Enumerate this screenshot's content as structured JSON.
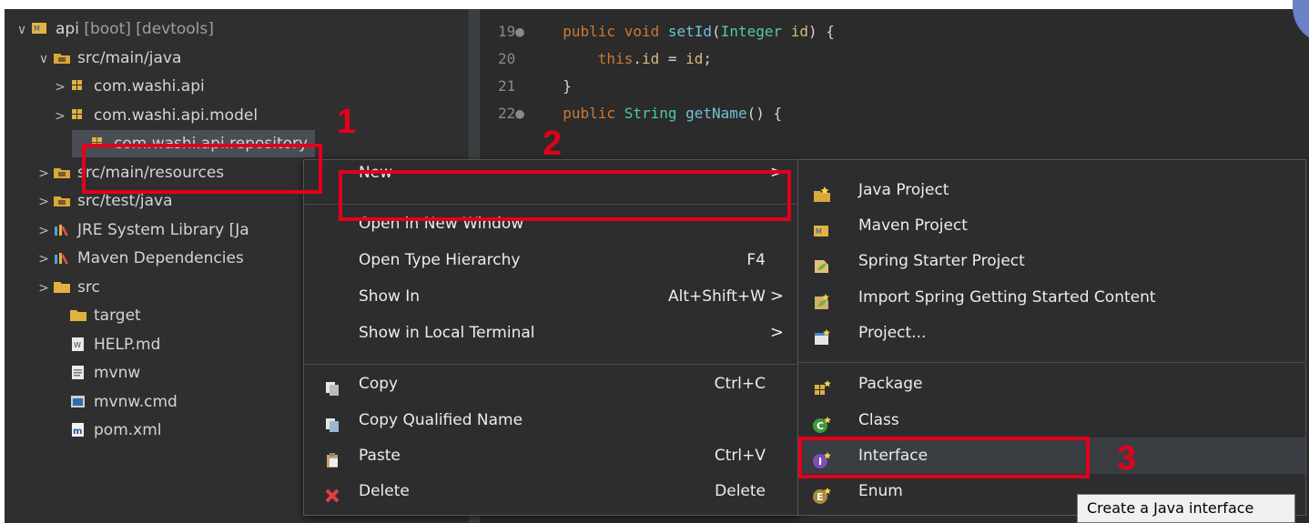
{
  "explorer": {
    "items": [
      {
        "label": "api",
        "suffix": "[boot] [devtools]",
        "arrow": "∨",
        "icon": "maven-project-icon"
      },
      {
        "label": "src/main/java",
        "arrow": "∨",
        "icon": "source-folder-icon"
      },
      {
        "label": "com.washi.api",
        "arrow": ">",
        "icon": "package-icon"
      },
      {
        "label": "com.washi.api.model",
        "arrow": ">",
        "icon": "package-icon"
      },
      {
        "label": "com.washi.api.repository",
        "arrow": "",
        "icon": "package-icon",
        "selected": true
      },
      {
        "label": "src/main/resources",
        "arrow": ">",
        "icon": "source-folder-icon"
      },
      {
        "label": "src/test/java",
        "arrow": ">",
        "icon": "source-folder-icon"
      },
      {
        "label": "JRE System Library [Ja",
        "arrow": ">",
        "icon": "library-icon"
      },
      {
        "label": "Maven Dependencies",
        "arrow": ">",
        "icon": "library-icon"
      },
      {
        "label": "src",
        "arrow": ">",
        "icon": "folder-icon"
      },
      {
        "label": "target",
        "arrow": "",
        "icon": "folder-icon"
      },
      {
        "label": "HELP.md",
        "arrow": "",
        "icon": "markdown-file-icon"
      },
      {
        "label": "mvnw",
        "arrow": "",
        "icon": "text-file-icon"
      },
      {
        "label": "mvnw.cmd",
        "arrow": "",
        "icon": "cmd-file-icon"
      },
      {
        "label": "pom.xml",
        "arrow": "",
        "icon": "maven-pom-icon"
      }
    ]
  },
  "editor": {
    "lines": [
      {
        "num": "19●",
        "code": [
          [
            "kw",
            "public "
          ],
          [
            "kw",
            "void "
          ],
          [
            "fn",
            "setId"
          ],
          [
            "pl",
            "("
          ],
          [
            "ty",
            "Integer "
          ],
          [
            "id",
            "id"
          ],
          [
            "pl",
            ") {"
          ]
        ]
      },
      {
        "num": "20",
        "code": [
          [
            "pl",
            "    "
          ],
          [
            "kw",
            "this"
          ],
          [
            "pl",
            "."
          ],
          [
            "id",
            "id"
          ],
          [
            "pl",
            " = "
          ],
          [
            "id",
            "id"
          ],
          [
            "pl",
            ";"
          ]
        ]
      },
      {
        "num": "21",
        "code": [
          [
            "pl",
            "}"
          ]
        ]
      },
      {
        "num": "22●",
        "code": [
          [
            "kw",
            "public "
          ],
          [
            "ty",
            "String "
          ],
          [
            "fn",
            "getName"
          ],
          [
            "pl",
            "() {"
          ]
        ]
      }
    ]
  },
  "context_menu": {
    "items": [
      {
        "label": "New",
        "shortcut": "",
        "submenu": true,
        "icon": ""
      },
      {
        "label": "Open in New Window",
        "shortcut": "",
        "submenu": false,
        "icon": ""
      },
      {
        "label": "Open Type Hierarchy",
        "shortcut": "F4",
        "submenu": false,
        "icon": ""
      },
      {
        "label": "Show In",
        "shortcut": "Alt+Shift+W",
        "submenu": true,
        "icon": ""
      },
      {
        "label": "Show in Local Terminal",
        "shortcut": "",
        "submenu": true,
        "icon": ""
      },
      {
        "label": "Copy",
        "shortcut": "Ctrl+C",
        "submenu": false,
        "icon": "copy-icon"
      },
      {
        "label": "Copy Qualified Name",
        "shortcut": "",
        "submenu": false,
        "icon": "copy-qualified-icon"
      },
      {
        "label": "Paste",
        "shortcut": "Ctrl+V",
        "submenu": false,
        "icon": "paste-icon"
      },
      {
        "label": "Delete",
        "shortcut": "Delete",
        "submenu": false,
        "icon": "delete-icon"
      }
    ],
    "submenu_arrow": ">"
  },
  "new_submenu": {
    "items": [
      {
        "label": "Java Project",
        "icon": "java-project-icon"
      },
      {
        "label": "Maven Project",
        "icon": "maven-project-icon"
      },
      {
        "label": "Spring Starter Project",
        "icon": "spring-project-icon"
      },
      {
        "label": "Import Spring Getting Started Content",
        "icon": "spring-import-icon"
      },
      {
        "label": "Project...",
        "icon": "project-icon"
      },
      {
        "label": "Package",
        "icon": "new-package-icon"
      },
      {
        "label": "Class",
        "icon": "class-icon"
      },
      {
        "label": "Interface",
        "icon": "interface-icon",
        "highlighted": true
      },
      {
        "label": "Enum",
        "icon": "enum-icon"
      }
    ]
  },
  "tooltip": "Create a Java interface",
  "annotations": {
    "step1": "1",
    "step2": "2",
    "step3": "3",
    "color": "#e3001b"
  }
}
